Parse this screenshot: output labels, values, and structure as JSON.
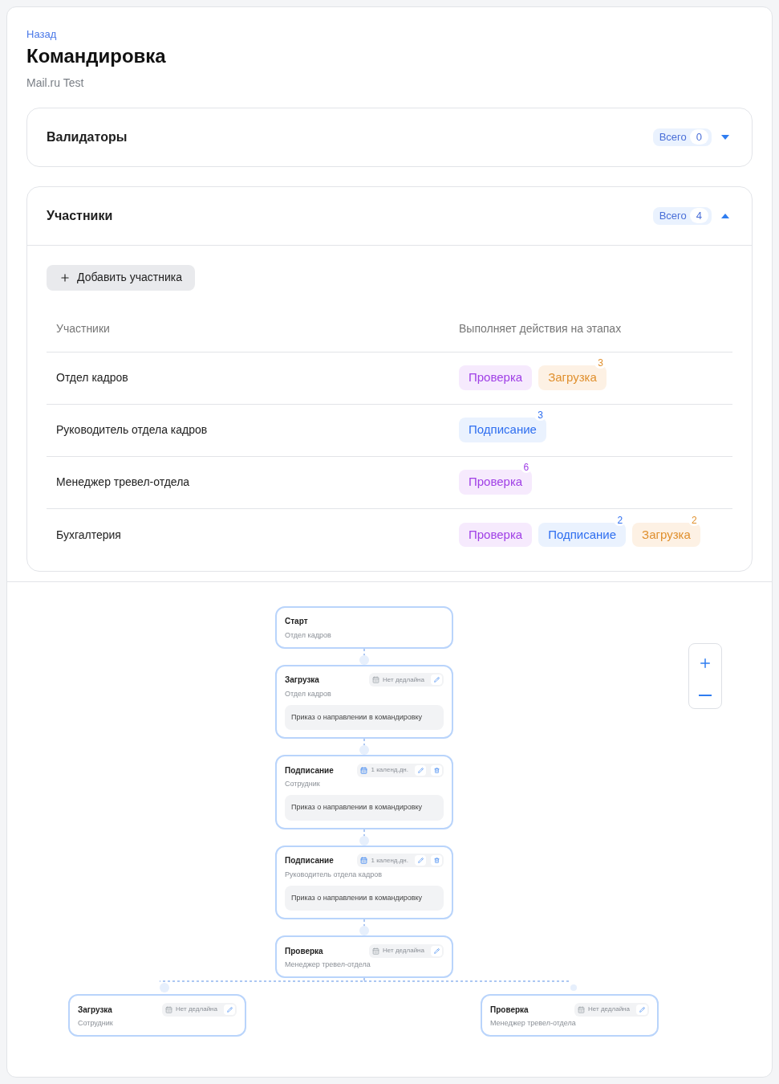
{
  "back_link": "Назад",
  "title": "Командировка",
  "subtitle": "Mail.ru Test",
  "sections": [
    {
      "title": "Валидаторы",
      "total_label": "Всего",
      "total": "0",
      "expanded": false
    },
    {
      "title": "Участники",
      "total_label": "Всего",
      "total": "4",
      "expanded": true
    }
  ],
  "add_button": "Добавить участника",
  "table": {
    "columns": [
      "Участники",
      "Выполняет действия на этапах"
    ],
    "rows": [
      {
        "name": "Отдел кадров",
        "stages": [
          {
            "label": "Проверка",
            "kind": "check"
          },
          {
            "label": "Загрузка",
            "kind": "upload",
            "count": "3"
          }
        ]
      },
      {
        "name": "Руководитель отдела кадров",
        "stages": [
          {
            "label": "Подписание",
            "kind": "sign",
            "count": "3"
          }
        ]
      },
      {
        "name": "Менеджер тревел-отдела",
        "stages": [
          {
            "label": "Проверка",
            "kind": "check",
            "count": "6"
          }
        ]
      },
      {
        "name": "Бухгалтерия",
        "stages": [
          {
            "label": "Проверка",
            "kind": "check"
          },
          {
            "label": "Подписание",
            "kind": "sign",
            "count": "2"
          },
          {
            "label": "Загрузка",
            "kind": "upload",
            "count": "2"
          }
        ]
      }
    ]
  },
  "flow": {
    "nodes": [
      {
        "kind": "start",
        "title": "Старт",
        "role": "Отдел кадров"
      },
      {
        "kind": "stage",
        "title": "Загрузка",
        "role": "Отдел кадров",
        "deadline": "Нет дедлайна",
        "deadline_set": false,
        "deletable": false,
        "document": "Приказ о направлении в командировку"
      },
      {
        "kind": "stage",
        "title": "Подписание",
        "role": "Сотрудник",
        "deadline": "1 календ.дн.",
        "deadline_set": true,
        "deletable": true,
        "document": "Приказ о направлении в командировку"
      },
      {
        "kind": "stage",
        "title": "Подписание",
        "role": "Руководитель отдела кадров",
        "deadline": "1 календ.дн.",
        "deadline_set": true,
        "deletable": true,
        "document": "Приказ о направлении в командировку"
      },
      {
        "kind": "stage",
        "title": "Проверка",
        "role": "Менеджер тревел-отдела",
        "deadline": "Нет дедлайна",
        "deadline_set": false,
        "deletable": false
      }
    ],
    "branches": [
      {
        "kind": "stage",
        "title": "Загрузка",
        "role": "Сотрудник",
        "deadline": "Нет дедлайна",
        "deadline_set": false,
        "deletable": false
      },
      {
        "kind": "stage",
        "title": "Проверка",
        "role": "Менеджер тревел-отдела",
        "deadline": "Нет дедлайна",
        "deadline_set": false,
        "deletable": false
      }
    ]
  }
}
